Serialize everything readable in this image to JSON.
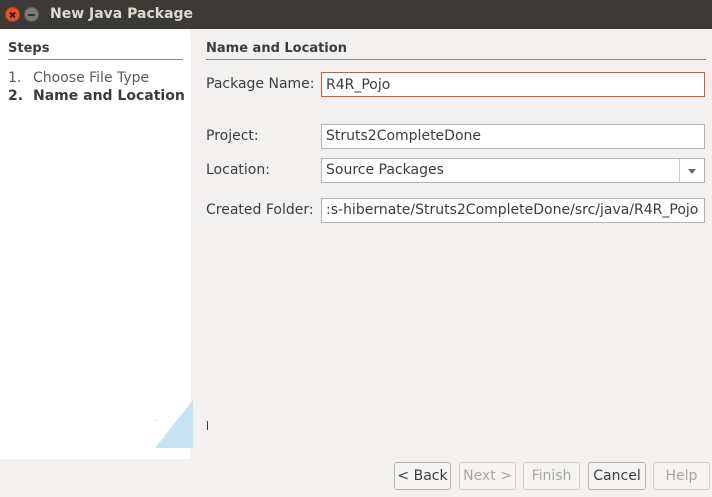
{
  "window": {
    "title": "New Java Package"
  },
  "steps": {
    "heading": "Steps",
    "items": [
      {
        "num": "1.",
        "label": "Choose File Type"
      },
      {
        "num": "2.",
        "label": "Name and Location"
      }
    ]
  },
  "main": {
    "heading": "Name and Location",
    "package_name": {
      "label": "Package Name:",
      "value": "R4R_Pojo"
    },
    "project": {
      "label": "Project:",
      "value": "Struts2CompleteDone"
    },
    "location": {
      "label": "Location:",
      "value": "Source Packages"
    },
    "created_folder": {
      "label": "Created Folder:",
      "value": ":s-hibernate/Struts2CompleteDone/src/java/R4R_Pojo"
    }
  },
  "footer": {
    "back": "< Back",
    "next": "Next >",
    "finish": "Finish",
    "cancel": "Cancel",
    "help": "Help"
  },
  "colors": {
    "accent": "#e8532b",
    "titlebar": "#3b3a36"
  }
}
